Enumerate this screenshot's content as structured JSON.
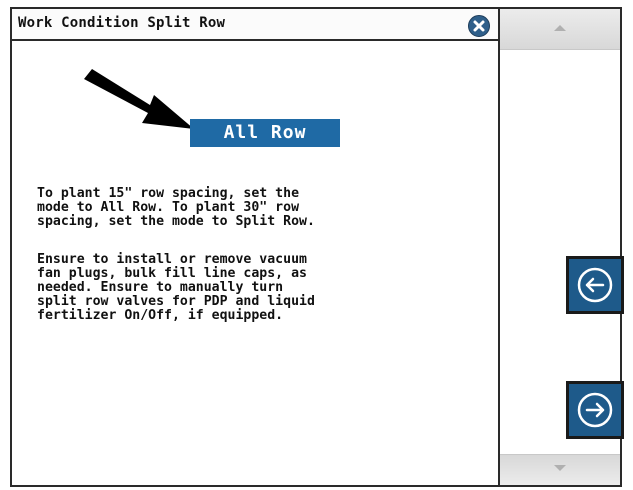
{
  "dialog": {
    "title": "Work Condition Split Row",
    "mode_value": "All Row",
    "paragraph_1": "To plant 15\" row spacing, set the\nmode to All Row. To plant 30\" row\nspacing, set the mode to Split Row.",
    "paragraph_2": "Ensure to install or remove vacuum\nfan plugs, bulk fill line caps, as\nneeded. Ensure to manually turn\nsplit row valves for PDP and liquid\nfertilizer On/Off, if equipped."
  },
  "icons": {
    "close": "close-icon",
    "pointer": "arrow-pointer-icon",
    "back": "arrow-left-circle-icon",
    "next": "arrow-right-circle-icon",
    "scroll_up": "chevron-up-icon",
    "scroll_down": "chevron-down-icon"
  },
  "colors": {
    "accent_blue": "#1f6aa5",
    "button_blue": "#1e5a8a",
    "border": "#2a2a2a"
  }
}
